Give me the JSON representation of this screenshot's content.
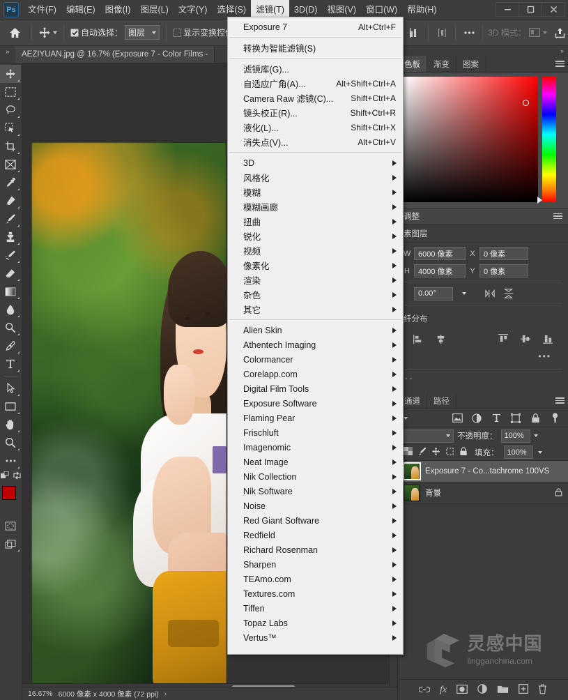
{
  "app": {
    "logo_text": "Ps",
    "menus": [
      {
        "label": "文件(F)",
        "active": false
      },
      {
        "label": "编辑(E)",
        "active": false
      },
      {
        "label": "图像(I)",
        "active": false
      },
      {
        "label": "图层(L)",
        "active": false
      },
      {
        "label": "文字(Y)",
        "active": false
      },
      {
        "label": "选择(S)",
        "active": false
      },
      {
        "label": "滤镜(T)",
        "active": true
      },
      {
        "label": "3D(D)",
        "active": false
      },
      {
        "label": "视图(V)",
        "active": false
      },
      {
        "label": "窗口(W)",
        "active": false
      },
      {
        "label": "帮助(H)",
        "active": false
      }
    ],
    "window_controls": {
      "minimize": "minimize-icon",
      "maximize": "maximize-icon",
      "close": "close-icon"
    }
  },
  "options_bar": {
    "home_icon": "home-icon",
    "tool_icon": "move-tool-icon",
    "auto_select_checked": true,
    "auto_select_label": "自动选择：",
    "auto_select_value": "图层",
    "show_transform_checked": false,
    "show_transform_label": "显示变换控件",
    "mode_3d_label": "3D 模式：",
    "more_icon": "more-options-icon",
    "share_icon": "share-icon"
  },
  "document_tab": {
    "title": "AEZIYUAN.jpg @ 16.7% (Exposure 7 - Color Films - ",
    "collapse_icon": "collapse-arrows-icon"
  },
  "toolbar": {
    "tools": [
      {
        "name": "move-tool",
        "selected": true
      },
      {
        "name": "rectangular-marquee-tool",
        "selected": false
      },
      {
        "name": "lasso-tool",
        "selected": false
      },
      {
        "name": "quick-selection-tool",
        "selected": false
      },
      {
        "name": "crop-tool",
        "selected": false
      },
      {
        "name": "frame-tool",
        "selected": false
      },
      {
        "name": "eyedropper-tool",
        "selected": false
      },
      {
        "name": "spot-healing-brush-tool",
        "selected": false
      },
      {
        "name": "brush-tool",
        "selected": false
      },
      {
        "name": "clone-stamp-tool",
        "selected": false
      },
      {
        "name": "history-brush-tool",
        "selected": false
      },
      {
        "name": "eraser-tool",
        "selected": false
      },
      {
        "name": "gradient-tool",
        "selected": false
      },
      {
        "name": "blur-tool",
        "selected": false
      },
      {
        "name": "dodge-tool",
        "selected": false
      },
      {
        "name": "pen-tool",
        "selected": false
      },
      {
        "name": "horizontal-type-tool",
        "selected": false
      },
      {
        "name": "path-selection-tool",
        "selected": false
      },
      {
        "name": "rectangle-tool",
        "selected": false
      },
      {
        "name": "hand-tool",
        "selected": false
      },
      {
        "name": "zoom-tool",
        "selected": false
      },
      {
        "name": "edit-toolbar-tool",
        "selected": false
      }
    ],
    "foreground_color": "#c00000",
    "background_color": "#ffffff"
  },
  "filter_menu": {
    "groups": [
      {
        "items": [
          {
            "label": "Exposure 7",
            "accel": "Alt+Ctrl+F",
            "submenu": false
          }
        ]
      },
      {
        "items": [
          {
            "label": "转换为智能滤镜(S)",
            "accel": "",
            "submenu": false
          }
        ]
      },
      {
        "items": [
          {
            "label": "滤镜库(G)...",
            "accel": "",
            "submenu": false
          },
          {
            "label": "自适应广角(A)...",
            "accel": "Alt+Shift+Ctrl+A",
            "submenu": false
          },
          {
            "label": "Camera Raw 滤镜(C)...",
            "accel": "Shift+Ctrl+A",
            "submenu": false
          },
          {
            "label": "镜头校正(R)...",
            "accel": "Shift+Ctrl+R",
            "submenu": false
          },
          {
            "label": "液化(L)...",
            "accel": "Shift+Ctrl+X",
            "submenu": false
          },
          {
            "label": "消失点(V)...",
            "accel": "Alt+Ctrl+V",
            "submenu": false
          }
        ]
      },
      {
        "items": [
          {
            "label": "3D",
            "accel": "",
            "submenu": true
          },
          {
            "label": "风格化",
            "accel": "",
            "submenu": true
          },
          {
            "label": "模糊",
            "accel": "",
            "submenu": true
          },
          {
            "label": "模糊画廊",
            "accel": "",
            "submenu": true
          },
          {
            "label": "扭曲",
            "accel": "",
            "submenu": true
          },
          {
            "label": "锐化",
            "accel": "",
            "submenu": true
          },
          {
            "label": "视频",
            "accel": "",
            "submenu": true
          },
          {
            "label": "像素化",
            "accel": "",
            "submenu": true
          },
          {
            "label": "渲染",
            "accel": "",
            "submenu": true
          },
          {
            "label": "杂色",
            "accel": "",
            "submenu": true
          },
          {
            "label": "其它",
            "accel": "",
            "submenu": true
          }
        ]
      },
      {
        "items": [
          {
            "label": "Alien Skin",
            "accel": "",
            "submenu": true
          },
          {
            "label": "Athentech Imaging",
            "accel": "",
            "submenu": true
          },
          {
            "label": "Colormancer",
            "accel": "",
            "submenu": true
          },
          {
            "label": "Corelapp.com",
            "accel": "",
            "submenu": true
          },
          {
            "label": "Digital Film Tools",
            "accel": "",
            "submenu": true
          },
          {
            "label": "Exposure Software",
            "accel": "",
            "submenu": true
          },
          {
            "label": "Flaming Pear",
            "accel": "",
            "submenu": true
          },
          {
            "label": "Frischluft",
            "accel": "",
            "submenu": true
          },
          {
            "label": "Imagenomic",
            "accel": "",
            "submenu": true
          },
          {
            "label": "Neat Image",
            "accel": "",
            "submenu": true
          },
          {
            "label": "Nik Collection",
            "accel": "",
            "submenu": true
          },
          {
            "label": "Nik Software",
            "accel": "",
            "submenu": true
          },
          {
            "label": "Noise",
            "accel": "",
            "submenu": true
          },
          {
            "label": "Red Giant Software",
            "accel": "",
            "submenu": true
          },
          {
            "label": "Redfield",
            "accel": "",
            "submenu": true
          },
          {
            "label": "Richard Rosenman",
            "accel": "",
            "submenu": true
          },
          {
            "label": "Sharpen",
            "accel": "",
            "submenu": true
          },
          {
            "label": "TEAmo.com",
            "accel": "",
            "submenu": true
          },
          {
            "label": "Textures.com",
            "accel": "",
            "submenu": true
          },
          {
            "label": "Tiffen",
            "accel": "",
            "submenu": true
          },
          {
            "label": "Topaz Labs",
            "accel": "",
            "submenu": true
          },
          {
            "label": "Vertus™",
            "accel": "",
            "submenu": true
          }
        ]
      }
    ]
  },
  "right_dock": {
    "color_tabs": [
      {
        "label": "色板",
        "active": false
      },
      {
        "label": "渐变",
        "active": false
      },
      {
        "label": "图案",
        "active": false
      }
    ],
    "color_picker": {
      "accent": "#ff0000"
    },
    "adjust_panel_title": "调整",
    "adjust_sub_text": "素图层",
    "properties": {
      "w_label": "W",
      "w_value": "6000 像素",
      "x_label": "X",
      "x_value": "0 像素",
      "h_label": "H",
      "h_value": "4000 像素",
      "y_label": "Y",
      "y_value": "0 像素",
      "angle_value": "0.00°",
      "flip_h_icon": "flip-horizontal-icon",
      "flip_v_icon": "flip-vertical-icon"
    },
    "align_section_title": "纤分布",
    "align_more": "•••",
    "dashes": "- -",
    "layers_tabs": [
      {
        "label": "通道",
        "active": false
      },
      {
        "label": "路径",
        "active": false
      }
    ],
    "filter_icons": [
      "image-filter-icon",
      "adjustment-filter-icon",
      "type-filter-icon",
      "shape-filter-icon",
      "smart-object-filter-icon",
      "toggle-filter-icon"
    ],
    "blend_opacity": {
      "label": "不透明度：",
      "value": "100%"
    },
    "lock": {
      "label": "填充：",
      "value": "100%"
    },
    "lock_icons": [
      "lock-transparent-icon",
      "lock-image-icon",
      "lock-position-icon",
      "lock-artboard-icon",
      "lock-all-icon"
    ],
    "layers": [
      {
        "name": "Exposure 7 - Co...tachrome 100VS",
        "selected": true,
        "locked": false
      },
      {
        "name": "背景",
        "selected": false,
        "locked": true
      }
    ],
    "footer_icons": [
      "link-layers-icon",
      "layer-style-fx-icon",
      "add-mask-icon",
      "adjustment-layer-icon",
      "new-group-icon",
      "new-layer-icon",
      "delete-layer-icon"
    ]
  },
  "watermark": {
    "chinese": "灵感中国",
    "english": "lingganchina",
    "domain": ".com"
  },
  "status_bar": {
    "zoom": "16.67%",
    "doc_size": "6000 像素 x 4000 像素 (72 ppi)",
    "expand_icon": "expand-arrow-icon"
  }
}
